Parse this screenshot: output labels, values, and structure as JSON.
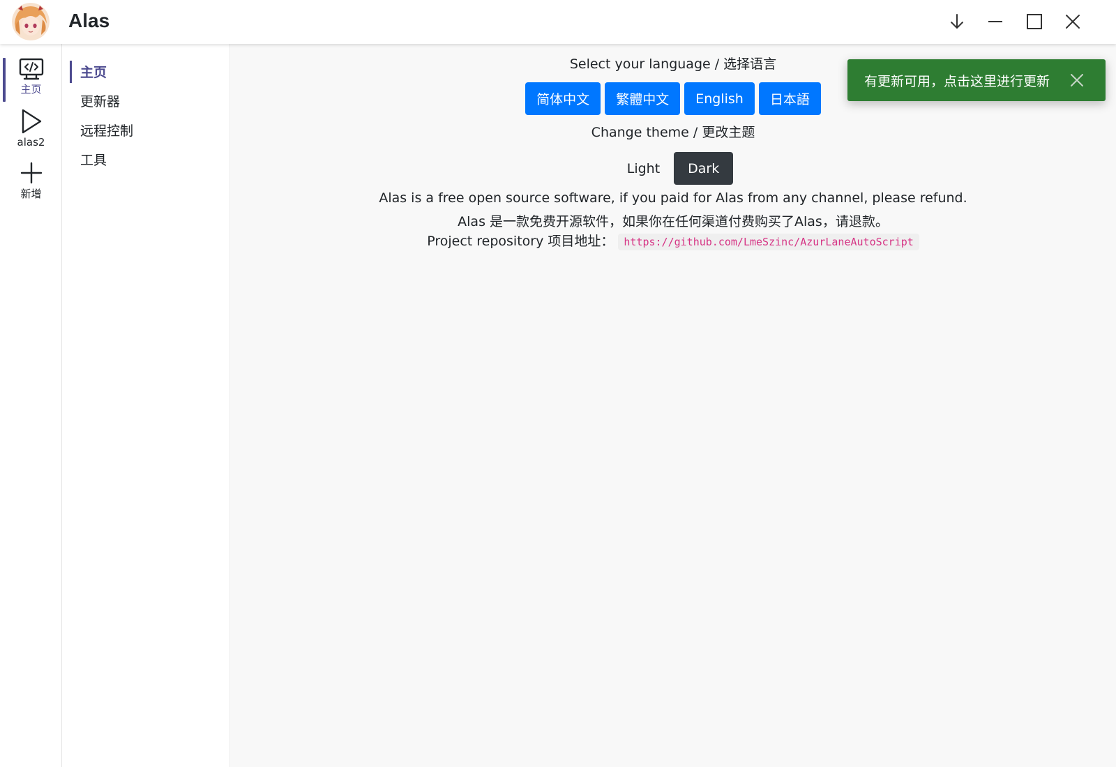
{
  "header": {
    "title": "Alas"
  },
  "rail": {
    "items": [
      {
        "label": "主页",
        "icon": "monitor-code-icon",
        "active": true
      },
      {
        "label": "alas2",
        "icon": "play-icon",
        "active": false
      },
      {
        "label": "新增",
        "icon": "plus-icon",
        "active": false
      }
    ]
  },
  "nav": {
    "items": [
      {
        "label": "主页",
        "active": true
      },
      {
        "label": "更新器",
        "active": false
      },
      {
        "label": "远程控制",
        "active": false
      },
      {
        "label": "工具",
        "active": false
      }
    ]
  },
  "main": {
    "language_heading": "Select your language / 选择语言",
    "languages": [
      "简体中文",
      "繁體中文",
      "English",
      "日本語"
    ],
    "theme_heading": "Change theme / 更改主题",
    "themes": {
      "light": "Light",
      "dark": "Dark"
    },
    "notice_en": "Alas is a free open source software, if you paid for Alas from any channel, please refund.",
    "notice_zh": "Alas 是一款免费开源软件，如果你在任何渠道付费购买了Alas，请退款。",
    "repo_label": "Project repository 项目地址：",
    "repo_url": "https://github.com/LmeSzinc/AzurLaneAutoScript"
  },
  "toast": {
    "message": "有更新可用，点击这里进行更新"
  },
  "colors": {
    "accent": "#4c4a8f",
    "primary_button": "#0077ff",
    "dark_button": "#343a40",
    "toast_bg": "#2e7d32",
    "code_text": "#d63384"
  }
}
